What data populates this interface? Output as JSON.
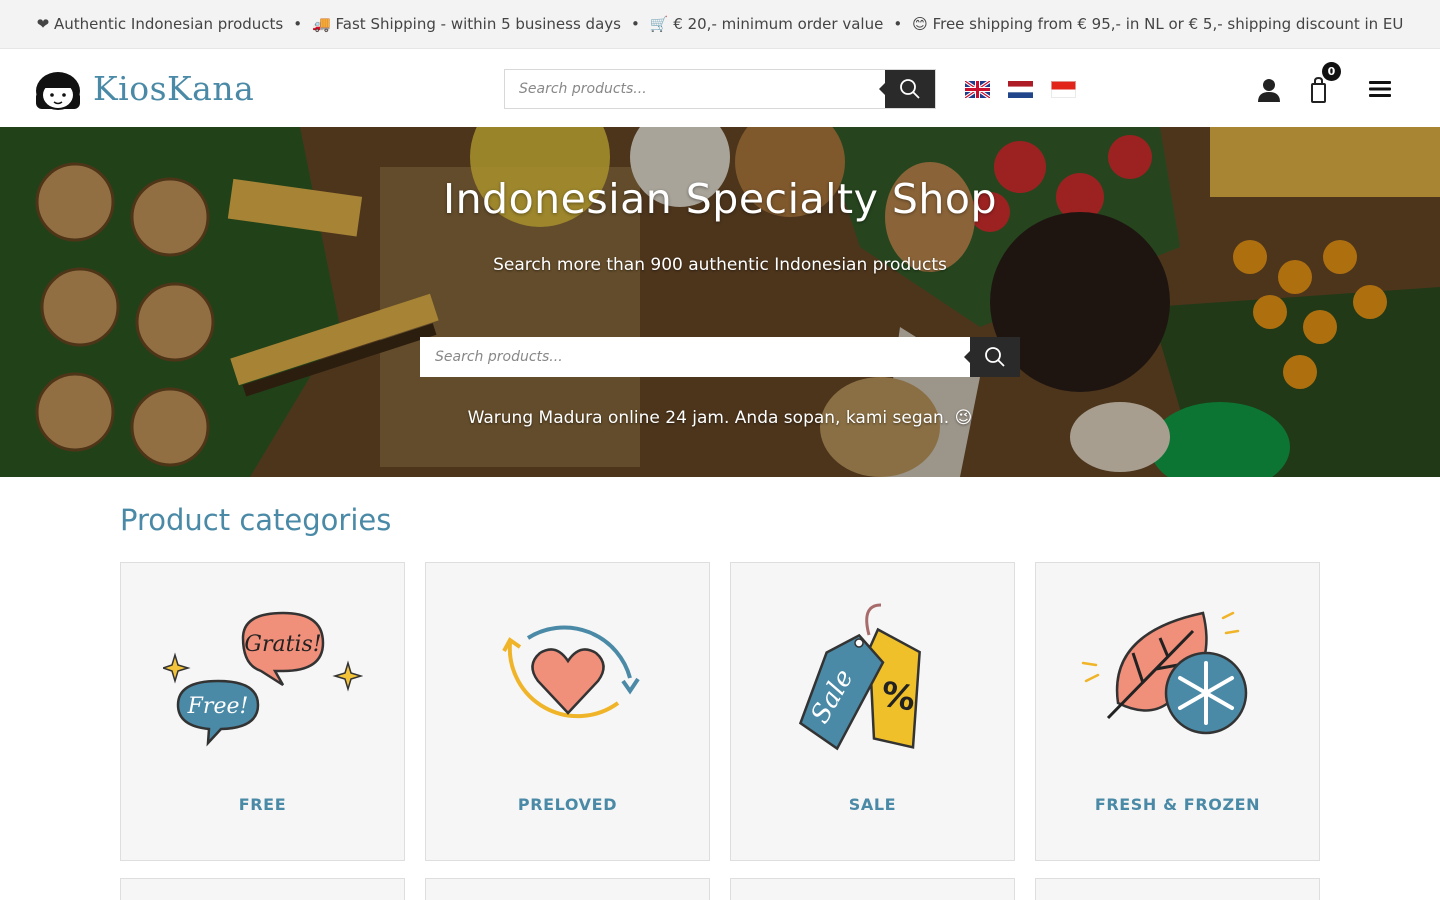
{
  "topbar": {
    "items": [
      "❤ Authentic Indonesian products",
      "🚚 Fast Shipping - within 5 business days",
      "🛒 € 20,- minimum order value",
      "😊 Free shipping from € 95,- in NL or € 5,- shipping discount in EU"
    ],
    "separator": "•"
  },
  "header": {
    "logo_text": "KiosKana",
    "search_placeholder": "Search products...",
    "languages": [
      "English",
      "Nederlands",
      "Bahasa Indonesia"
    ],
    "cart_count": "0",
    "icons": [
      "account-icon",
      "cart-icon",
      "menu-icon"
    ]
  },
  "hero": {
    "title": "Indonesian Specialty Shop",
    "subtitle": "Search more than 900 authentic Indonesian products",
    "search_placeholder": "Search products...",
    "tagline": "Warung Madura online 24 jam. Anda sopan, kami segan. 😉"
  },
  "categories": {
    "heading": "Product categories",
    "items": [
      {
        "label": "FREE",
        "icon": "free-speech-bubbles-icon"
      },
      {
        "label": "PRELOVED",
        "icon": "heart-recycle-icon"
      },
      {
        "label": "SALE",
        "icon": "sale-tags-icon"
      },
      {
        "label": "FRESH & FROZEN",
        "icon": "leaf-snowflake-icon"
      }
    ]
  },
  "colors": {
    "accent": "#4a8aa7",
    "dark": "#2a2a2a",
    "topbar_bg": "#f3f3f3",
    "card_bg": "#f6f6f6"
  }
}
